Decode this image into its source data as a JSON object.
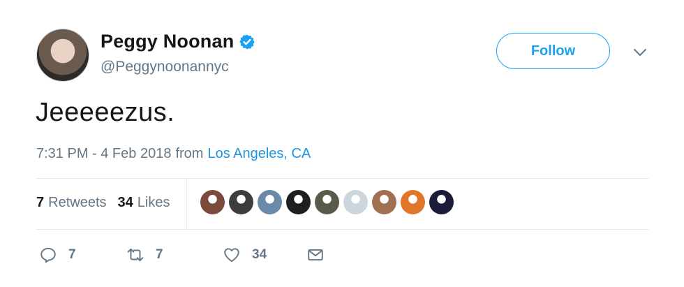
{
  "author": {
    "name": "Peggy Noonan",
    "handle": "@Peggynoonannyc",
    "verified": true
  },
  "follow_label": "Follow",
  "tweet": {
    "text": "Jeeeeezus.",
    "time": "7:31 PM - 4 Feb 2018",
    "from": "from",
    "location": "Los Angeles, CA"
  },
  "stats": {
    "retweets_count": "7",
    "retweets_label": "Retweets",
    "likes_count": "34",
    "likes_label": "Likes"
  },
  "likers": [
    {
      "color": "#7a4a3a"
    },
    {
      "color": "#3d3d3d"
    },
    {
      "color": "#6a8aa8"
    },
    {
      "color": "#1f1f1f"
    },
    {
      "color": "#5a5a4a"
    },
    {
      "color": "#ccd6dd"
    },
    {
      "color": "#a07050"
    },
    {
      "color": "#e0762a"
    },
    {
      "color": "#1b1b3a"
    }
  ],
  "actions": {
    "reply_count": "7",
    "retweet_count": "7",
    "like_count": "34"
  },
  "colors": {
    "accent": "#1da1f2",
    "muted": "#657786",
    "link": "#1b95e0"
  }
}
